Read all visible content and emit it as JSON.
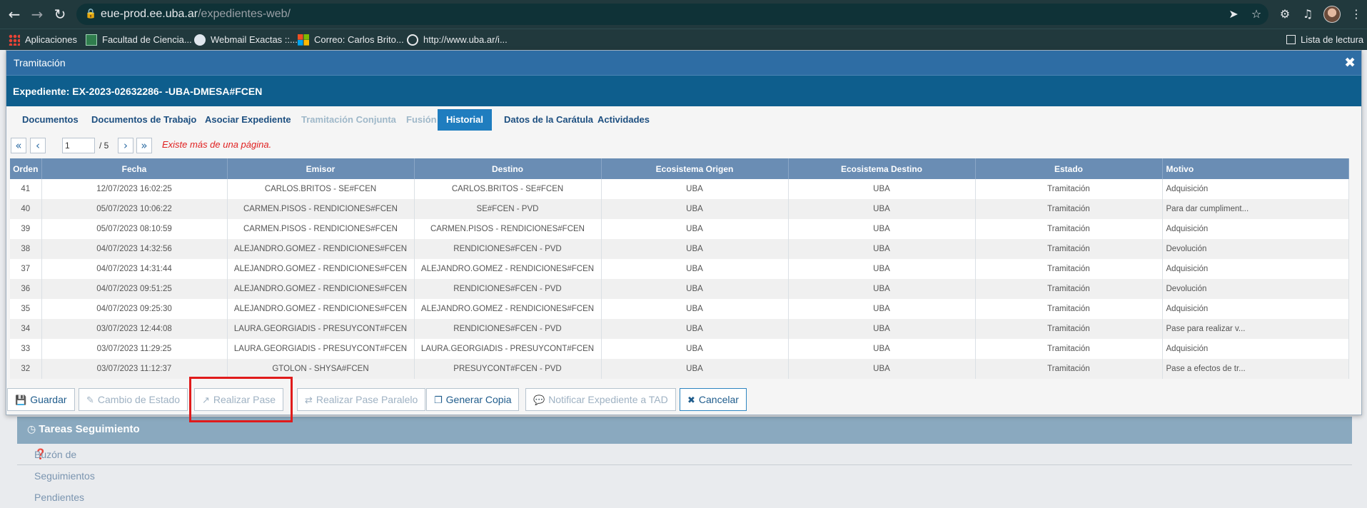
{
  "browser": {
    "url_host": "eue-prod.ee.uba.ar",
    "url_path": "/expedientes-web/",
    "bookmarks": [
      {
        "label": "Aplicaciones"
      },
      {
        "label": "Facultad de Ciencia..."
      },
      {
        "label": "Webmail Exactas ::..."
      },
      {
        "label": "Correo: Carlos Brito..."
      },
      {
        "label": "http://www.uba.ar/i..."
      }
    ],
    "reading_list": "Lista de lectura"
  },
  "modal": {
    "title": "Tramitación",
    "close": "✖",
    "expediente": "Expediente: EX-2023-02632286- -UBA-DMESA#FCEN",
    "tabs": [
      {
        "label": "Documentos",
        "state": "enabled"
      },
      {
        "label": "Documentos de Trabajo",
        "state": "enabled"
      },
      {
        "label": "Asociar Expediente",
        "state": "enabled"
      },
      {
        "label": "Tramitación Conjunta",
        "state": "disabled"
      },
      {
        "label": "Fusión",
        "state": "disabled"
      },
      {
        "label": "Historial",
        "state": "active"
      },
      {
        "label": "Datos de la Carátula",
        "state": "enabled"
      },
      {
        "label": "Actividades",
        "state": "enabled"
      }
    ],
    "pager": {
      "first": "«",
      "prev": "‹",
      "page": "1",
      "total": "/ 5",
      "next": "›",
      "last": "»",
      "warning": "Existe más de una página."
    },
    "table": {
      "headers": [
        "Orden",
        "Fecha",
        "Emisor",
        "Destino",
        "Ecosistema Origen",
        "Ecosistema Destino",
        "Estado",
        "Motivo"
      ],
      "rows": [
        [
          "41",
          "12/07/2023 16:02:25",
          "CARLOS.BRITOS - SE#FCEN",
          "CARLOS.BRITOS - SE#FCEN",
          "UBA",
          "UBA",
          "Tramitación",
          "Adquisición"
        ],
        [
          "40",
          "05/07/2023 10:06:22",
          "CARMEN.PISOS - RENDICIONES#FCEN",
          "SE#FCEN - PVD",
          "UBA",
          "UBA",
          "Tramitación",
          "Para dar cumpliment..."
        ],
        [
          "39",
          "05/07/2023 08:10:59",
          "CARMEN.PISOS - RENDICIONES#FCEN",
          "CARMEN.PISOS - RENDICIONES#FCEN",
          "UBA",
          "UBA",
          "Tramitación",
          "Adquisición"
        ],
        [
          "38",
          "04/07/2023 14:32:56",
          "ALEJANDRO.GOMEZ - RENDICIONES#FCEN",
          "RENDICIONES#FCEN - PVD",
          "UBA",
          "UBA",
          "Tramitación",
          "Devolución"
        ],
        [
          "37",
          "04/07/2023 14:31:44",
          "ALEJANDRO.GOMEZ - RENDICIONES#FCEN",
          "ALEJANDRO.GOMEZ - RENDICIONES#FCEN",
          "UBA",
          "UBA",
          "Tramitación",
          "Adquisición"
        ],
        [
          "36",
          "04/07/2023 09:51:25",
          "ALEJANDRO.GOMEZ - RENDICIONES#FCEN",
          "RENDICIONES#FCEN - PVD",
          "UBA",
          "UBA",
          "Tramitación",
          "Devolución"
        ],
        [
          "35",
          "04/07/2023 09:25:30",
          "ALEJANDRO.GOMEZ - RENDICIONES#FCEN",
          "ALEJANDRO.GOMEZ - RENDICIONES#FCEN",
          "UBA",
          "UBA",
          "Tramitación",
          "Adquisición"
        ],
        [
          "34",
          "03/07/2023 12:44:08",
          "LAURA.GEORGIADIS - PRESUYCONT#FCEN",
          "RENDICIONES#FCEN - PVD",
          "UBA",
          "UBA",
          "Tramitación",
          "Pase para realizar v..."
        ],
        [
          "33",
          "03/07/2023 11:29:25",
          "LAURA.GEORGIADIS - PRESUYCONT#FCEN",
          "LAURA.GEORGIADIS - PRESUYCONT#FCEN",
          "UBA",
          "UBA",
          "Tramitación",
          "Adquisición"
        ],
        [
          "32",
          "03/07/2023 11:12:37",
          "GTOLON - SHYSA#FCEN",
          "PRESUYCONT#FCEN - PVD",
          "UBA",
          "UBA",
          "Tramitación",
          "Pase a efectos de tr..."
        ]
      ]
    },
    "buttons": {
      "guardar": "Guardar",
      "cambio_estado": "Cambio de Estado",
      "realizar_pase": "Realizar Pase",
      "realizar_pase_paralelo": "Realizar Pase Paralelo",
      "generar_copia": "Generar Copia",
      "notificar_tad": "Notificar Expediente a TAD",
      "cancelar": "Cancelar"
    }
  },
  "background": {
    "tareas_title": "Tareas Seguimiento",
    "buzon_label": "Buzón de Seguimientos Pendientes"
  },
  "colors": {
    "modal_title_bar": "#2e6da4",
    "expediente_bar": "#0e5e8d",
    "table_header": "#6a8db4",
    "active_tab": "#1f7dbf",
    "highlight": "#e01b1b"
  }
}
